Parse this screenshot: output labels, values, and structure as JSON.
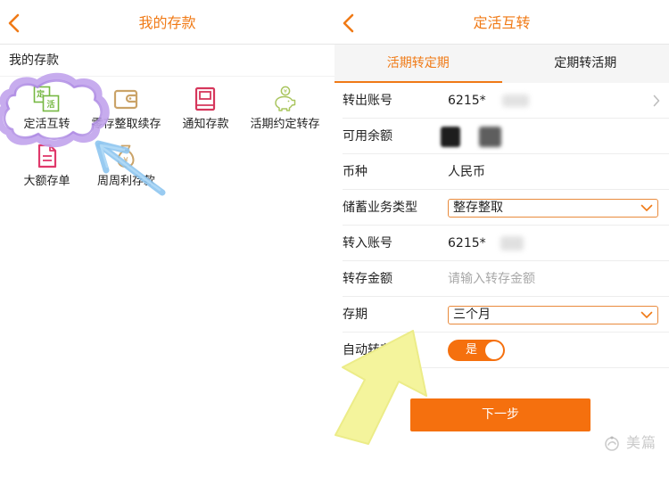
{
  "left_screen": {
    "header": {
      "title": "我的存款",
      "back_icon": "chevron-left-icon"
    },
    "section_title": "我的存款",
    "items": [
      {
        "label": "定活互转",
        "icon": "transfer-icon",
        "icon_text": [
          "定",
          "活"
        ]
      },
      {
        "label": "零存整取续存",
        "icon": "wallet-icon"
      },
      {
        "label": "通知存款",
        "icon": "book-icon"
      },
      {
        "label": "活期约定转存",
        "icon": "piggy-bank-icon",
        "icon_text": [
          "¥"
        ]
      },
      {
        "label": "大额存单",
        "icon": "document-icon"
      },
      {
        "label": "周周利存款",
        "icon": "money-bag-icon",
        "icon_text": [
          "¥"
        ]
      }
    ]
  },
  "right_screen": {
    "header": {
      "title": "定活互转",
      "back_icon": "chevron-left-icon"
    },
    "tabs": [
      {
        "label": "活期转定期",
        "active": true
      },
      {
        "label": "定期转活期",
        "active": false
      }
    ],
    "form": {
      "out_account": {
        "label": "转出账号",
        "value": "6215*",
        "icon": "chevron-right-icon"
      },
      "balance": {
        "label": "可用余额"
      },
      "currency": {
        "label": "币种",
        "value": "人民币"
      },
      "deposit_type": {
        "label": "储蓄业务类型",
        "value": "整存整取",
        "icon": "chevron-down-icon"
      },
      "in_account": {
        "label": "转入账号",
        "value": "6215*"
      },
      "amount": {
        "label": "转存金额",
        "placeholder": "请输入转存金额"
      },
      "term": {
        "label": "存期",
        "value": "三个月",
        "icon": "chevron-down-icon"
      },
      "auto_renew": {
        "label": "自动转存",
        "value": "是",
        "on": true
      }
    },
    "next_button": "下一步"
  },
  "watermark": {
    "text": "美篇",
    "icon": "meipian-logo-icon"
  },
  "colors": {
    "accent": "#f07a16",
    "button": "#f5700e",
    "select_border": "#e98a3c",
    "text": "#222222",
    "placeholder": "#a8a8a8",
    "green_icon": "#76b843",
    "gold_icon": "#caa368",
    "red_icon": "#d6375c",
    "pink_icon": "#e0396b",
    "piggy_icon": "#a9c55e",
    "annotation_purple": "#c1a3ec",
    "annotation_blue": "#8ec5f0",
    "annotation_yellow": "#f4f49c"
  }
}
